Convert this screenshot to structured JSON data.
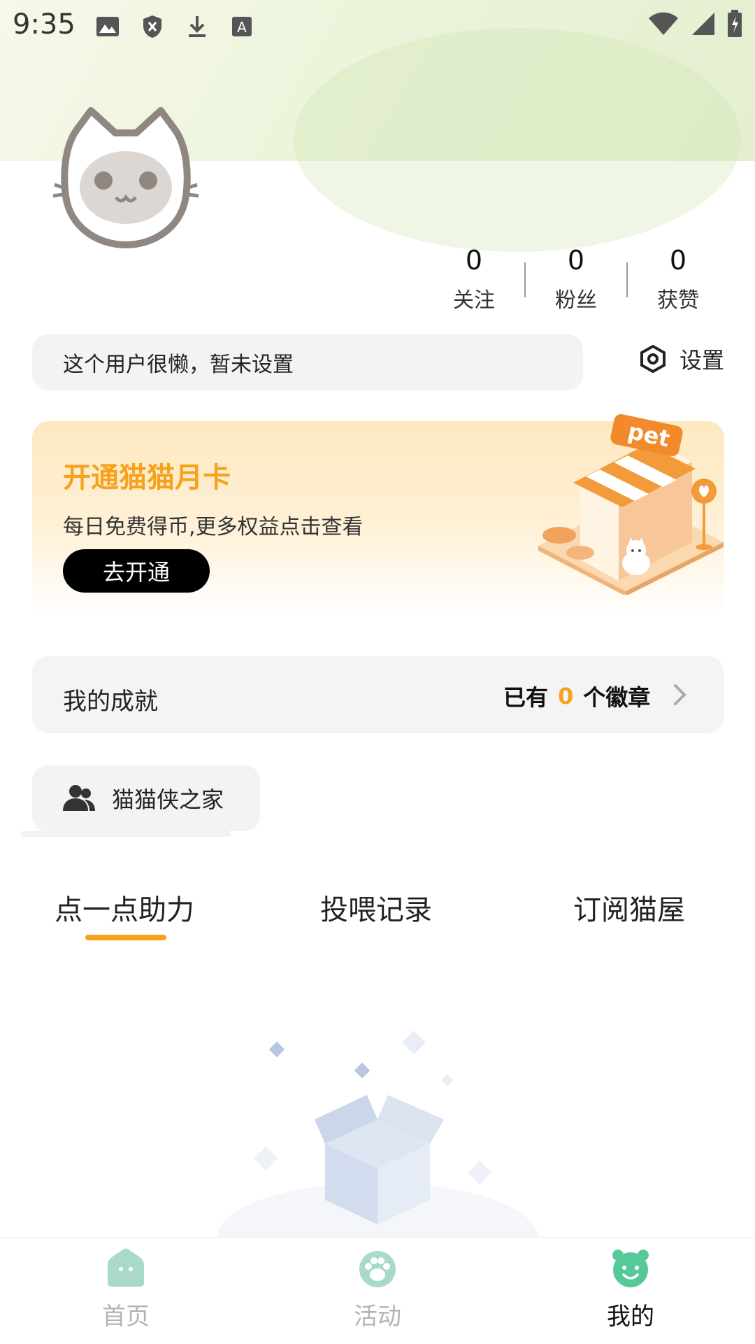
{
  "status_bar": {
    "time": "9:35",
    "icons": [
      "image-icon",
      "shield-icon",
      "download-icon",
      "font-icon"
    ],
    "right_icons": [
      "wifi-icon",
      "signal-icon",
      "battery-icon"
    ]
  },
  "profile": {
    "stats": [
      {
        "value": "0",
        "label": "关注"
      },
      {
        "value": "0",
        "label": "粉丝"
      },
      {
        "value": "0",
        "label": "获赞"
      }
    ],
    "bio": "这个用户很懒，暂未设置",
    "settings_label": "设置"
  },
  "promo": {
    "title": "开通猫猫月卡",
    "subtitle": "每日免费得币,更多权益点击查看",
    "button_label": "去开通",
    "shop_sign": "pet"
  },
  "achievement": {
    "label": "我的成就",
    "prefix": "已有",
    "count": "0",
    "suffix": "个徽章"
  },
  "home_chip": {
    "label": "猫猫侠之家"
  },
  "tabs": [
    {
      "label": "点一点助力",
      "active": true
    },
    {
      "label": "投喂记录",
      "active": false
    },
    {
      "label": "订阅猫屋",
      "active": false
    }
  ],
  "bottom_nav": [
    {
      "label": "首页",
      "icon": "home-icon",
      "active": false
    },
    {
      "label": "活动",
      "icon": "paw-icon",
      "active": false
    },
    {
      "label": "我的",
      "icon": "cat-face-icon",
      "active": true
    }
  ],
  "colors": {
    "accent": "#f6a21c",
    "nav_inactive_icon": "#a9d9c7",
    "nav_active_icon": "#56c99b",
    "nav_inactive_text": "#b3b3b3"
  }
}
